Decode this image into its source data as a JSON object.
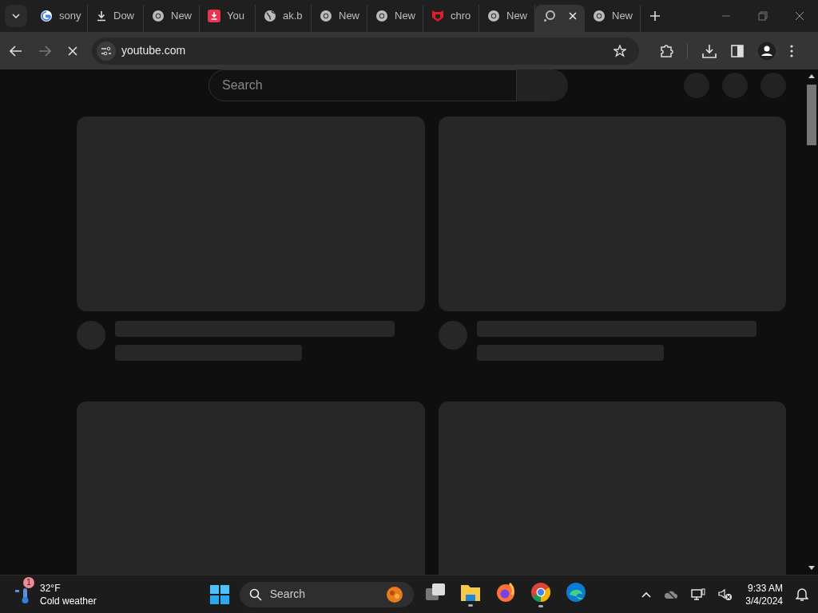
{
  "tabs": [
    {
      "label": "sony",
      "kind": "google",
      "selected": false
    },
    {
      "label": "Dow",
      "kind": "download",
      "selected": false
    },
    {
      "label": "New",
      "kind": "chrome",
      "selected": false
    },
    {
      "label": "You",
      "kind": "app",
      "selected": false
    },
    {
      "label": "ak.b",
      "kind": "globe",
      "selected": false
    },
    {
      "label": "New",
      "kind": "chrome",
      "selected": false
    },
    {
      "label": "New",
      "kind": "chrome",
      "selected": false
    },
    {
      "label": "chro",
      "kind": "shield",
      "selected": false
    },
    {
      "label": "New",
      "kind": "chrome",
      "selected": false
    },
    {
      "kind": "loading",
      "selected": true
    },
    {
      "label": "New",
      "kind": "chrome",
      "selected": false
    }
  ],
  "address_bar": {
    "url": "youtube.com"
  },
  "page": {
    "search": {
      "placeholder": "Search"
    }
  },
  "taskbar": {
    "weather": {
      "badge": "1",
      "temperature": "32°F",
      "condition": "Cold weather"
    },
    "search": {
      "placeholder": "Search"
    },
    "apps": [
      {
        "kind": "taskview",
        "running": false
      },
      {
        "kind": "explorer",
        "running": true
      },
      {
        "kind": "firefox",
        "running": false
      },
      {
        "kind": "chrome",
        "running": true
      },
      {
        "kind": "edge",
        "running": false
      }
    ],
    "time": "9:33 AM",
    "date": "3/4/2024"
  }
}
